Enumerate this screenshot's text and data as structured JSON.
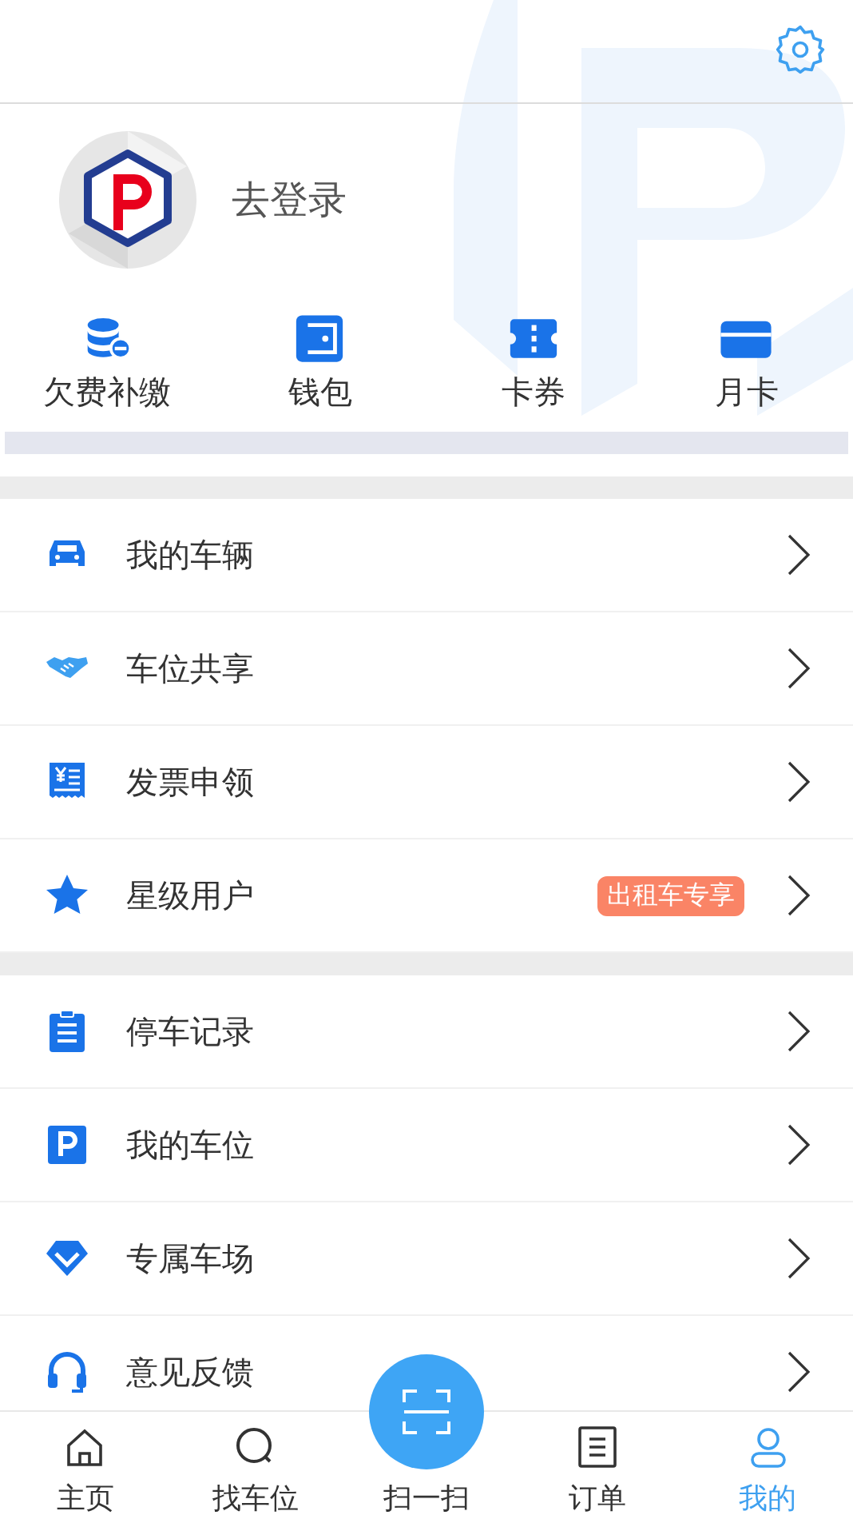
{
  "profile": {
    "login_label": "去登录"
  },
  "quick_actions": [
    {
      "label": "欠费补缴"
    },
    {
      "label": "钱包"
    },
    {
      "label": "卡券"
    },
    {
      "label": "月卡"
    }
  ],
  "menu_sections": [
    {
      "items": [
        {
          "label": "我的车辆"
        },
        {
          "label": "车位共享"
        },
        {
          "label": "发票申领"
        },
        {
          "label": "星级用户",
          "badge": "出租车专享"
        }
      ]
    },
    {
      "items": [
        {
          "label": "停车记录"
        },
        {
          "label": "我的车位"
        },
        {
          "label": "专属车场"
        },
        {
          "label": "意见反馈"
        }
      ]
    }
  ],
  "tab_bar": [
    {
      "label": "主页",
      "kind": "home",
      "selected": false
    },
    {
      "label": "找车位",
      "kind": "search",
      "selected": false
    },
    {
      "label": "扫一扫",
      "kind": "scan",
      "selected": false
    },
    {
      "label": "订单",
      "kind": "orders",
      "selected": false
    },
    {
      "label": "我的",
      "kind": "profile",
      "selected": true
    }
  ]
}
